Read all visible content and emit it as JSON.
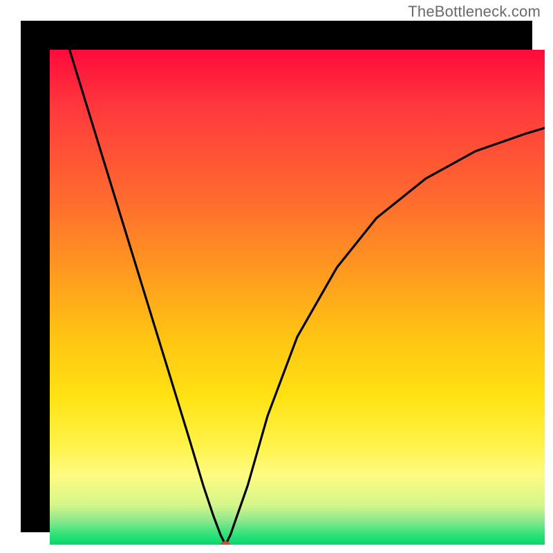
{
  "watermark": "TheBottleneck.com",
  "chart_data": {
    "type": "line",
    "title": "",
    "xlabel": "",
    "ylabel": "",
    "xlim": [
      0,
      100
    ],
    "ylim": [
      0,
      100
    ],
    "grid": false,
    "legend": false,
    "series": [
      {
        "name": "curve",
        "x": [
          4,
          8,
          12,
          16,
          20,
          24,
          28,
          31,
          33,
          34.5,
          35.5,
          36.5,
          40,
          44,
          50,
          58,
          66,
          76,
          86,
          96,
          100
        ],
        "y": [
          100,
          87,
          74,
          61,
          48,
          35,
          22,
          12,
          6,
          2,
          0,
          2,
          12,
          26,
          42,
          56,
          66,
          74,
          79.5,
          83,
          84.2
        ]
      }
    ],
    "marker": {
      "x": 35.5,
      "y": 0,
      "color": "#cc4b3f"
    },
    "background_gradient": [
      {
        "stop": 0.0,
        "color": "#ff0a3c"
      },
      {
        "stop": 0.3,
        "color": "#ff6a2f"
      },
      {
        "stop": 0.58,
        "color": "#ffc413"
      },
      {
        "stop": 0.8,
        "color": "#fff34a"
      },
      {
        "stop": 0.95,
        "color": "#8fe98c"
      },
      {
        "stop": 1.0,
        "color": "#07d76a"
      }
    ],
    "frame_color": "#000000"
  }
}
